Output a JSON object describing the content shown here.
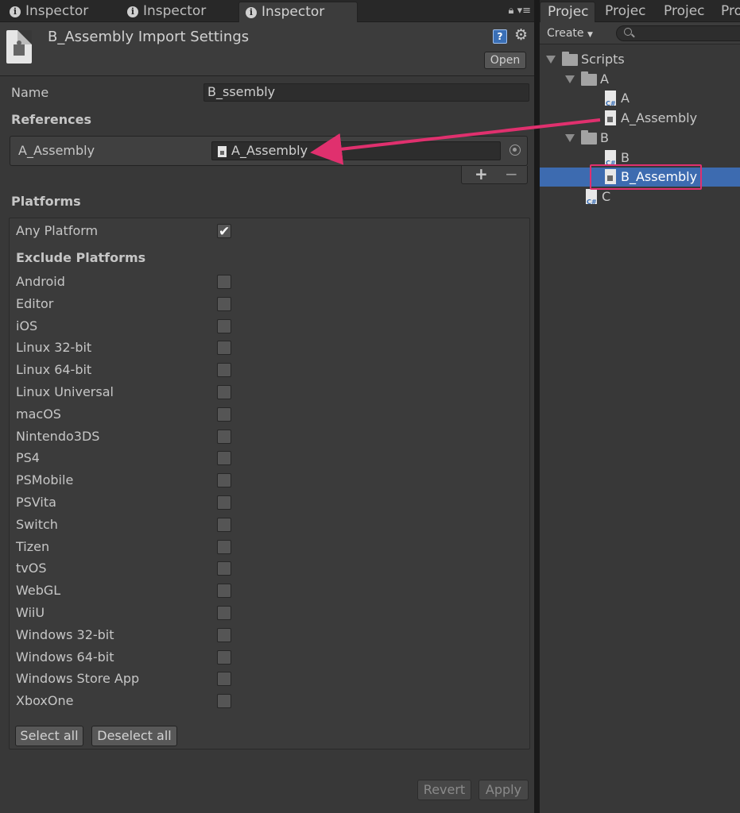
{
  "inspector": {
    "tabs": [
      {
        "label": "Inspector"
      },
      {
        "label": "Inspector"
      },
      {
        "label": "Inspector"
      }
    ],
    "header": {
      "title": "B_Assembly Import Settings",
      "open_label": "Open",
      "help_glyph": "?",
      "gear_glyph": "⚙"
    },
    "name_label": "Name",
    "name_value": "B_ssembly",
    "references_label": "References",
    "reference": {
      "label": "A_Assembly",
      "value": "A_Assembly"
    },
    "platforms_label": "Platforms",
    "any_platform": {
      "label": "Any Platform",
      "checked": true
    },
    "exclude_label": "Exclude Platforms",
    "platforms": [
      "Android",
      "Editor",
      "iOS",
      "Linux 32-bit",
      "Linux 64-bit",
      "Linux Universal",
      "macOS",
      "Nintendo3DS",
      "PS4",
      "PSMobile",
      "PSVita",
      "Switch",
      "Tizen",
      "tvOS",
      "WebGL",
      "WiiU",
      "Windows 32-bit",
      "Windows 64-bit",
      "Windows Store App",
      "XboxOne"
    ],
    "select_all": "Select all",
    "deselect_all": "Deselect all",
    "revert": "Revert",
    "apply": "Apply"
  },
  "project": {
    "tabs": [
      {
        "label": "Projec"
      },
      {
        "label": "Projec"
      },
      {
        "label": "Projec"
      },
      {
        "label": "Pro"
      }
    ],
    "create_label": "Create",
    "tree": [
      {
        "label": "Scripts",
        "type": "folder",
        "depth": 0,
        "expanded": true
      },
      {
        "label": "A",
        "type": "folder",
        "depth": 1,
        "expanded": true
      },
      {
        "label": "A",
        "type": "cs",
        "depth": 2
      },
      {
        "label": "A_Assembly",
        "type": "asm",
        "depth": 2
      },
      {
        "label": "B",
        "type": "folder",
        "depth": 1,
        "expanded": true
      },
      {
        "label": "B",
        "type": "cs",
        "depth": 2
      },
      {
        "label": "B_Assembly",
        "type": "asm",
        "depth": 2,
        "selected": true
      },
      {
        "label": "C",
        "type": "cs",
        "depth": 1
      }
    ]
  },
  "colors": {
    "selection": "#3d6bb0",
    "annotation": "#e0306e"
  }
}
